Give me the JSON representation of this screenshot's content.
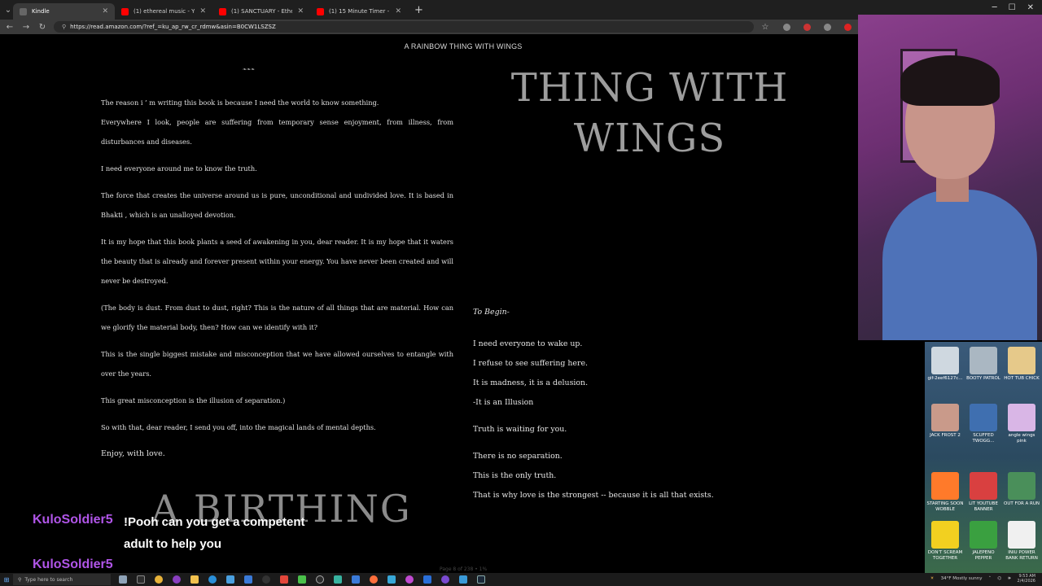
{
  "browser": {
    "tabs": [
      {
        "title": "Kindle",
        "active": true,
        "favicon_color": "#555555"
      },
      {
        "title": "(1) ethereal music - YouTube",
        "active": false,
        "favicon_color": "#ff0000"
      },
      {
        "title": "(1) SANCTUARY - Ethereal Am",
        "active": false,
        "favicon_color": "#ff0000"
      },
      {
        "title": "(1) 15 Minute Timer - YouTube",
        "active": false,
        "favicon_color": "#ff0000"
      }
    ],
    "new_tab": "+",
    "url": "https://read.amazon.com/?ref_=ku_ap_rw_cr_rdmw&asin=B0CW1LSZSZ"
  },
  "book": {
    "header_title": "A RAINBOW THING WITH WINGS",
    "ornament": "❧❧❧",
    "left_paragraphs": [
      "The reason i ’ m writing this book is because I need the world to know something.",
      "Everywhere I look, people are suffering from temporary sense enjoyment, from illness, from disturbances and diseases.",
      "I need everyone around me to know the truth.",
      "The force that creates the universe around us is pure, unconditional and undivided love. It is based in Bhakti , which is an unalloyed devotion.",
      "It is my hope that this book plants a seed of awakening in you, dear reader. It is my hope that it waters the beauty that is already and forever present within your energy. You have never been created and will never be destroyed.",
      "(The body is dust. From dust to dust, right? This is the nature of all things that are material. How can we glorify the material body, then? How can we identify with it?",
      "This is the single biggest mistake and misconception that we have allowed ourselves to entangle with over the years.",
      "This great misconception is the illusion of separation.)",
      "So with that, dear reader, I send you off, into the magical lands of mental depths."
    ],
    "enjoy": "Enjoy, with love.",
    "chapter_heading_line1": "THING WITH",
    "chapter_heading_line2": "WINGS",
    "to_begin": "To Begin-",
    "right_lines": [
      "I need everyone to wake up.",
      "I refuse to see suffering here.",
      "It is madness, it is a delusion.",
      "-It is an Illusion"
    ],
    "truth_waiting": "Truth is waiting for you.",
    "closing_lines": [
      "There is no separation.",
      "This is the only truth.",
      "That is why love is the strongest -- because it is all that exists."
    ],
    "next_chapter": "A BIRTHING",
    "page_info": "Page 8 of 238 • 1%"
  },
  "chat": {
    "user1": "KuloSoldier5",
    "message1": "!Pooh can you get a competent adult to help you",
    "user2": "KuloSoldier5"
  },
  "desktop_icons": [
    {
      "label": "gif-2eef6127c...",
      "color": "#cfd8e0"
    },
    {
      "label": "BOOTY PATROL",
      "color": "#aab7c2"
    },
    {
      "label": "HOT TUB CHICK",
      "color": "#e6c98a"
    },
    {
      "label": "JACK FROST 2",
      "color": "#c99a8a"
    },
    {
      "label": "SCUFFED TWOGG...",
      "color": "#3f6fb0"
    },
    {
      "label": "angle wings pink",
      "color": "#d9b6e6"
    },
    {
      "label": "STARTING SOON WOBBLE",
      "color": "#ff7a2a"
    },
    {
      "label": "LIT YOUTUBE BANNER",
      "color": "#d94040"
    },
    {
      "label": "OUT FOR A RUN",
      "color": "#4a8f5a"
    },
    {
      "label": "DON'T SCREAM TOGETHER",
      "color": "#f2d020"
    },
    {
      "label": "JALEPENO PEPPER",
      "color": "#3aa040"
    },
    {
      "label": "INIU POWER BANK RETURN",
      "color": "#f0f0f0"
    }
  ],
  "taskbar": {
    "search_placeholder": "Type here to search",
    "weather": "34°F  Mostly sunny",
    "time": "9:53 AM",
    "date": "2/4/2026"
  }
}
